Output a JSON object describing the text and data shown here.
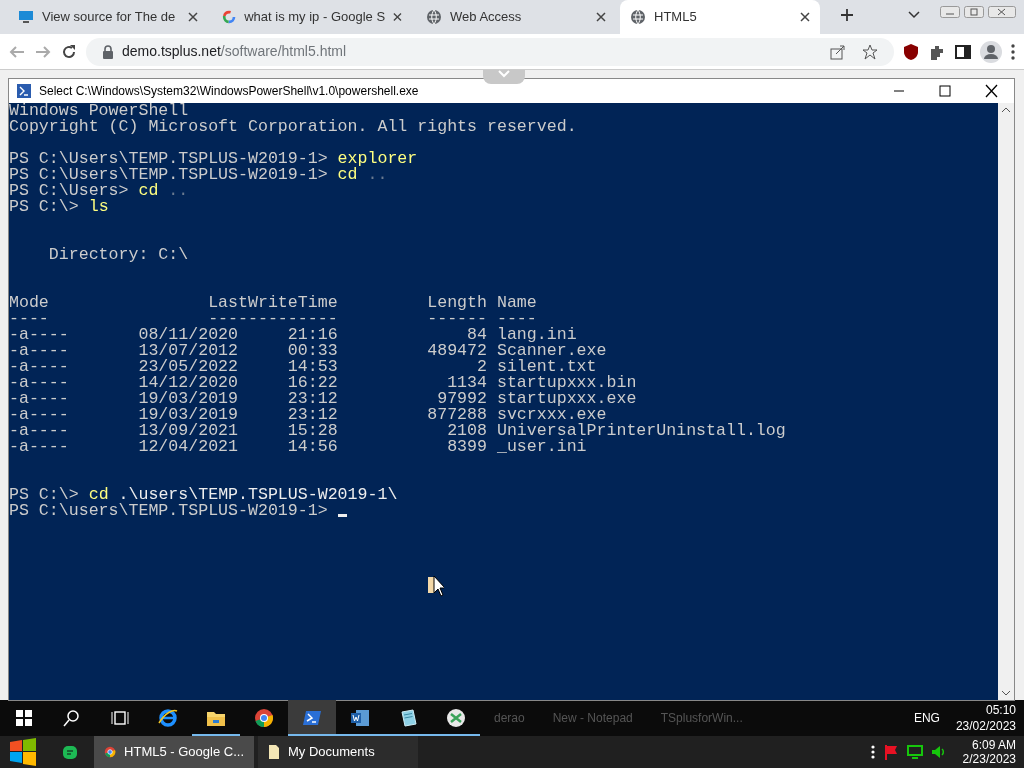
{
  "browser": {
    "tabs": [
      {
        "title": "View source for The de",
        "kind": "monitor",
        "selected": false
      },
      {
        "title": "what is my ip - Google S",
        "kind": "google",
        "selected": false
      },
      {
        "title": "Web Access",
        "kind": "globe",
        "selected": false
      },
      {
        "title": "HTML5",
        "kind": "globe",
        "selected": true
      }
    ],
    "address": {
      "host": "demo.tsplus.net",
      "path": "/software/html5.html"
    }
  },
  "console": {
    "title": "Select C:\\Windows\\System32\\WindowsPowerShell\\v1.0\\powershell.exe",
    "lines": [
      {
        "kind": "output",
        "text": "Windows PowerShell"
      },
      {
        "kind": "output",
        "text": "Copyright (C) Microsoft Corporation. All rights reserved."
      },
      {
        "kind": "blank"
      },
      {
        "kind": "prompt",
        "prompt": "PS C:\\Users\\TEMP.TSPLUS-W2019-1>",
        "command": "explorer"
      },
      {
        "kind": "prompt",
        "prompt": "PS C:\\Users\\TEMP.TSPLUS-W2019-1>",
        "command": "cd",
        "argument": "..",
        "dim": true
      },
      {
        "kind": "prompt",
        "prompt": "PS C:\\Users>",
        "command": "cd",
        "argument": "..",
        "dim": true
      },
      {
        "kind": "prompt",
        "prompt": "PS C:\\>",
        "command": "ls"
      },
      {
        "kind": "blank"
      },
      {
        "kind": "blank"
      },
      {
        "kind": "output",
        "text": "    Directory: C:\\"
      },
      {
        "kind": "blank"
      },
      {
        "kind": "blank"
      },
      {
        "kind": "output",
        "text": "Mode                LastWriteTime         Length Name"
      },
      {
        "kind": "output",
        "text": "----                -------------         ------ ----"
      },
      {
        "kind": "output",
        "text": "-a----       08/11/2020     21:16             84 lang.ini"
      },
      {
        "kind": "output",
        "text": "-a----       13/07/2012     00:33         489472 Scanner.exe"
      },
      {
        "kind": "output",
        "text": "-a----       23/05/2022     14:53              2 silent.txt"
      },
      {
        "kind": "output",
        "text": "-a----       14/12/2020     16:22           1134 startupxxx.bin"
      },
      {
        "kind": "output",
        "text": "-a----       19/03/2019     23:12          97992 startupxxx.exe"
      },
      {
        "kind": "output",
        "text": "-a----       19/03/2019     23:12         877288 svcrxxx.exe"
      },
      {
        "kind": "output",
        "text": "-a----       13/09/2021     15:28           2108 UniversalPrinterUninstall.log"
      },
      {
        "kind": "output",
        "text": "-a----       12/04/2021     14:56           8399 _user.ini"
      },
      {
        "kind": "blank"
      },
      {
        "kind": "blank"
      },
      {
        "kind": "prompt",
        "prompt": "PS C:\\>",
        "command": "cd",
        "argument": ".\\users\\TEMP.TSPLUS-W2019-1\\",
        "dim": false
      },
      {
        "kind": "prompt",
        "prompt": "PS C:\\users\\TEMP.TSPLUS-W2019-1>",
        "cursor": true
      }
    ]
  },
  "remote_taskbar": {
    "pinned": [
      {
        "kind": "start",
        "selected": false,
        "running": false
      },
      {
        "kind": "search",
        "selected": false,
        "running": false
      },
      {
        "kind": "taskview",
        "selected": false,
        "running": false
      },
      {
        "kind": "ie",
        "selected": false,
        "running": false
      },
      {
        "kind": "folder",
        "selected": false,
        "running": true
      },
      {
        "kind": "chrome",
        "selected": false,
        "running": false
      },
      {
        "kind": "powershell",
        "selected": true,
        "running": true
      },
      {
        "kind": "word",
        "selected": false,
        "running": true
      },
      {
        "kind": "notepad",
        "selected": false,
        "running": true
      },
      {
        "kind": "tsplus",
        "selected": false,
        "running": true
      }
    ],
    "windows": [
      "derao",
      "New - Notepad",
      "TSplusforWin..."
    ],
    "language": "ENG",
    "time": "05:10",
    "date": "23/02/2023"
  },
  "local_taskbar": {
    "apps": [
      {
        "label": "HTML5 - Google C...",
        "kind": "chrome",
        "selected": true
      },
      {
        "label": "My Documents",
        "kind": "document",
        "selected": false
      }
    ],
    "time": "6:09 AM",
    "date": "2/23/2023"
  }
}
